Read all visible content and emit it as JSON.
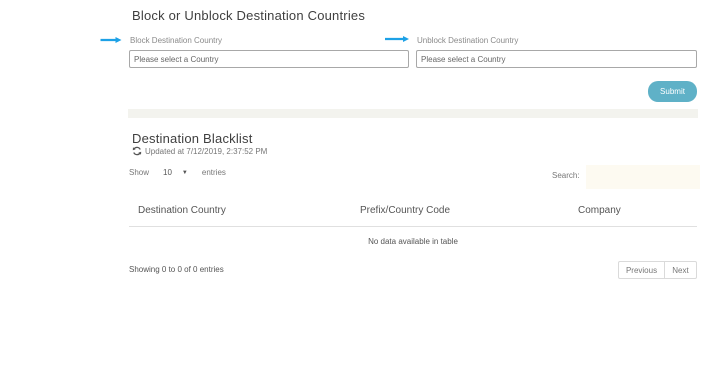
{
  "section_title": "Block or Unblock Destination Countries",
  "block": {
    "label": "Block Destination Country",
    "placeholder": "Please select a Country"
  },
  "unblock": {
    "label": "Unblock Destination Country",
    "placeholder": "Please select a Country"
  },
  "submit_label": "Submit",
  "blacklist": {
    "title": "Destination Blacklist",
    "updated": "Updated at 7/12/2019, 2:37:52 PM",
    "show_label": "Show",
    "entries_value": "10",
    "entries_label": "entries",
    "search_label": "Search:",
    "columns": [
      "Destination Country",
      "Prefix/Country Code",
      "Company"
    ],
    "empty_message": "No data available in table",
    "info": "Showing 0 to 0 of 0 entries",
    "previous_label": "Previous",
    "next_label": "Next"
  },
  "colors": {
    "arrow": "#1da1e6",
    "submit": "#5fb1c7",
    "divider_bar": "#f3f3ee"
  }
}
